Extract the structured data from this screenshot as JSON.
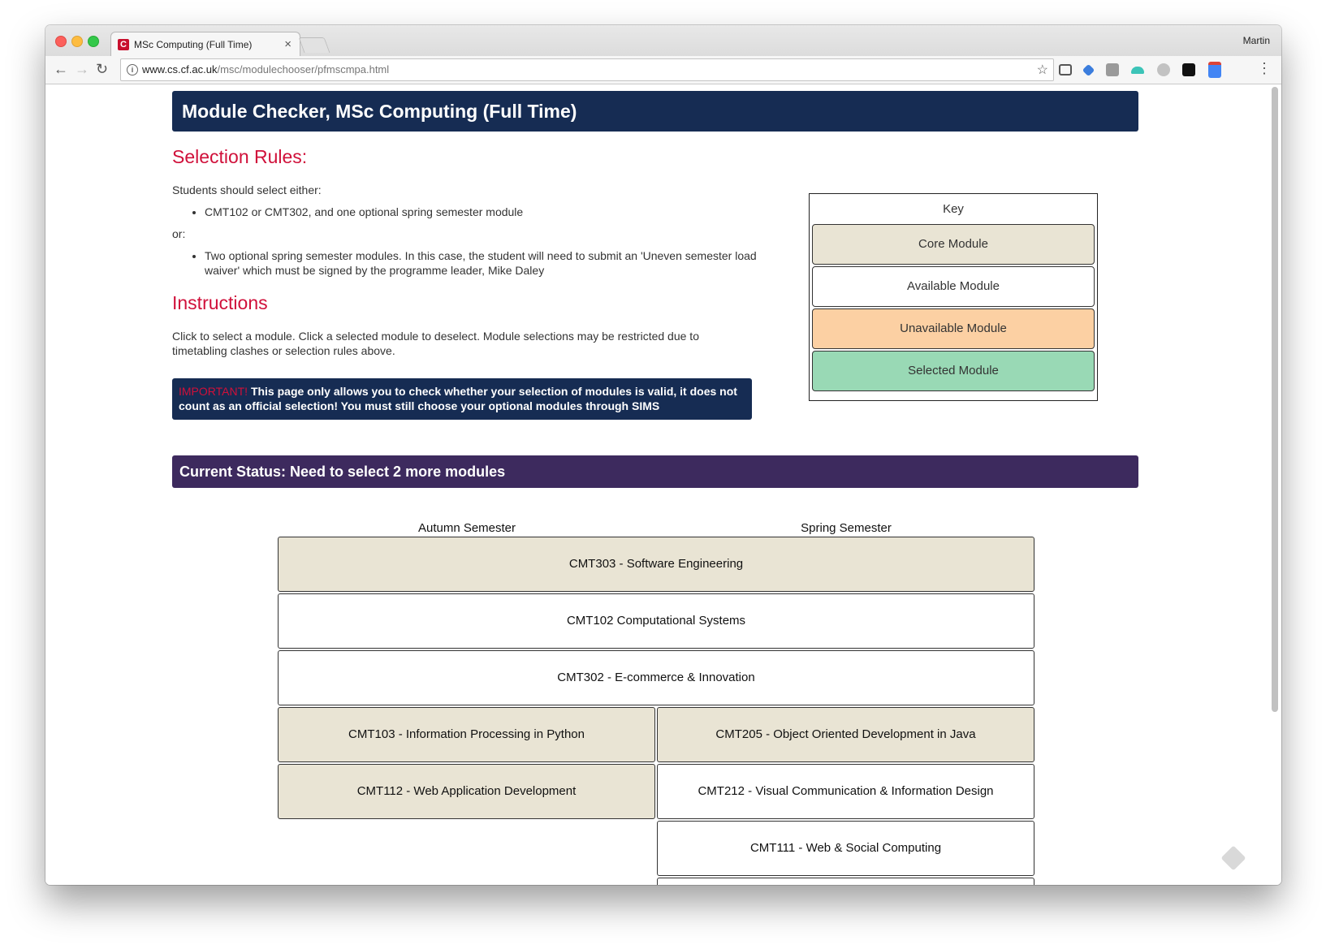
{
  "browser": {
    "tab_title": "MSc Computing (Full Time)",
    "tab_close": "×",
    "favicon_letter": "C",
    "profile_name": "Martin",
    "url_host": "www.cs.cf.ac.uk",
    "url_path": "/msc/modulechooser/pfmscmpa.html",
    "back_icon": "←",
    "forward_icon": "→",
    "reload_icon": "↻",
    "info_icon": "i",
    "star_icon": "☆",
    "menu_icon": "⋮",
    "extensions": [
      "cast-icon",
      "extension-blue-icon",
      "extension-gs-icon",
      "extension-teal-icon",
      "extension-grey-icon",
      "amazon-icon",
      "calendar-1m-icon"
    ]
  },
  "page": {
    "title": "Module Checker, MSc Computing (Full Time)",
    "selection_rules_heading": "Selection Rules:",
    "students_text": "Students should select either:",
    "rule1": "CMT102 or CMT302, and one optional spring semester module",
    "or_text": "or:",
    "rule2": "Two optional spring semester modules. In this case, the student will need to submit an 'Uneven semester load waiver' which must be signed by the programme leader, Mike Daley",
    "instructions_heading": "Instructions",
    "instructions_text": "Click to select a module. Click a selected module to deselect. Module selections may be restricted due to timetabling clashes or selection rules above.",
    "important_label": "IMPORTANT!",
    "important_text": "This page only allows you to check whether your selection of modules is valid, it does not count as an official selection! You must still choose your optional modules through SIMS",
    "status": "Current Status: Need to select 2 more modules",
    "autumn_label": "Autumn Semester",
    "spring_label": "Spring Semester"
  },
  "key": {
    "title": "Key",
    "items": [
      {
        "label": "Core Module",
        "color": "#e9e4d4"
      },
      {
        "label": "Available Module",
        "color": "#ffffff"
      },
      {
        "label": "Unavailable Module",
        "color": "#fcd0a3"
      },
      {
        "label": "Selected Module",
        "color": "#99d9b5"
      }
    ]
  },
  "modules": {
    "full_width": [
      {
        "label": "CMT303 - Software Engineering",
        "status": "core"
      },
      {
        "label": "CMT102 Computational Systems",
        "status": "available"
      },
      {
        "label": "CMT302 - E-commerce & Innovation",
        "status": "available"
      }
    ],
    "autumn": [
      {
        "label": "CMT103 - Information Processing in Python",
        "status": "core"
      },
      {
        "label": "CMT112 - Web Application Development",
        "status": "core"
      }
    ],
    "spring": [
      {
        "label": "CMT205 - Object Oriented Development in Java",
        "status": "core"
      },
      {
        "label": "CMT212 - Visual Communication & Information Design",
        "status": "available"
      },
      {
        "label": "CMT111 - Web & Social Computing",
        "status": "available"
      },
      {
        "label": "",
        "status": "available"
      }
    ]
  },
  "colors": {
    "header_navy": "#162c53",
    "status_purple": "#3d2a5e",
    "heading_red": "#d0103a",
    "core": "#e9e4d4",
    "available": "#ffffff",
    "unavailable": "#fcd0a3",
    "selected": "#99d9b5"
  }
}
